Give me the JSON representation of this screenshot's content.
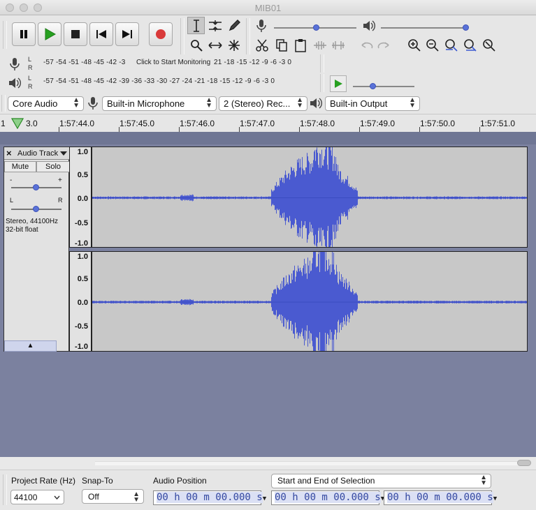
{
  "window": {
    "title": "MIB01"
  },
  "transport": {
    "pause": "pause-icon",
    "play": "play-icon",
    "stop": "stop-icon",
    "skip_start": "skip-start-icon",
    "skip_end": "skip-end-icon",
    "record": "record-icon",
    "record_color": "#d93a3a",
    "play_color": "#27a020"
  },
  "meters": {
    "record_ticks": "-57 -54 -51 -48 -45 -42 -3",
    "record_monitor": "Click to Start Monitoring",
    "record_ticks_tail": "21 -18 -15 -12 -9 -6 -3 0",
    "play_ticks": "-57 -54 -51 -48 -45 -42 -39 -36 -33 -30 -27 -24 -21 -18 -15 -12 -9 -6 -3 0",
    "channel_l": "L",
    "channel_r": "R"
  },
  "devices": {
    "host": "Core Audio",
    "input": "Built-in Microphone",
    "channels": "2 (Stereo) Rec...",
    "output": "Built-in Output"
  },
  "ruler": {
    "start": "1",
    "labels": [
      "3.0",
      "1:57:44.0",
      "1:57:45.0",
      "1:57:46.0",
      "1:57:47.0",
      "1:57:48.0",
      "1:57:49.0",
      "1:57:50.0",
      "1:57:51.0"
    ]
  },
  "track": {
    "close": "×",
    "name": "Audio Track",
    "mute": "Mute",
    "solo": "Solo",
    "gain_minus": "-",
    "gain_plus": "+",
    "pan_l": "L",
    "pan_r": "R",
    "info_line1": "Stereo, 44100Hz",
    "info_line2": "32-bit float",
    "collapse": "▲",
    "scale": [
      "1.0",
      "0.5",
      "0.0",
      "-0.5",
      "-1.0"
    ],
    "wave_color": "#4a5ad0"
  },
  "status": {
    "project_rate_label": "Project Rate (Hz)",
    "project_rate_value": "44100",
    "snap_label": "Snap-To",
    "snap_value": "Off",
    "audio_pos_label": "Audio Position",
    "selection_mode": "Start and End of Selection",
    "audio_pos_value": "00 h 00 m 00.000 s",
    "sel_start_value": "00 h 00 m 00.000 s",
    "sel_end_value": "00 h 00 m 00.000 s"
  }
}
